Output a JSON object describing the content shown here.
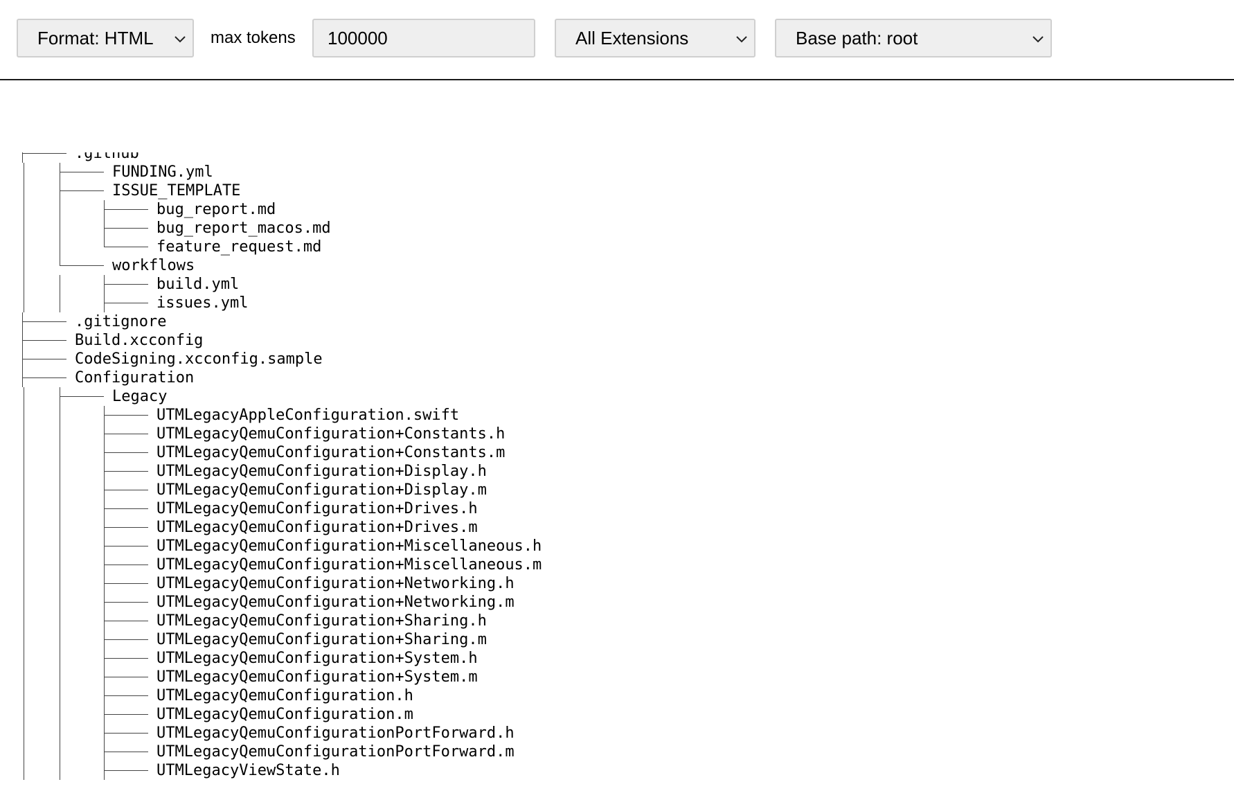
{
  "toolbar": {
    "format_label": "Format: HTML",
    "max_tokens_label": "max tokens",
    "max_tokens_value": "100000",
    "extensions_label": "All Extensions",
    "base_path_label": "Base path: root"
  },
  "tree": [
    {
      "name": ".github",
      "depth": 0,
      "last": false
    },
    {
      "name": "FUNDING.yml",
      "depth": 1,
      "last": false
    },
    {
      "name": "ISSUE_TEMPLATE",
      "depth": 1,
      "last": false
    },
    {
      "name": "bug_report.md",
      "depth": 2,
      "last": false
    },
    {
      "name": "bug_report_macos.md",
      "depth": 2,
      "last": false
    },
    {
      "name": "feature_request.md",
      "depth": 2,
      "last": true
    },
    {
      "name": "workflows",
      "depth": 1,
      "last": true
    },
    {
      "name": "build.yml",
      "depth": 2,
      "last": false
    },
    {
      "name": "issues.yml",
      "depth": 2,
      "last": false
    },
    {
      "name": ".gitignore",
      "depth": 0,
      "last": false
    },
    {
      "name": "Build.xcconfig",
      "depth": 0,
      "last": false
    },
    {
      "name": "CodeSigning.xcconfig.sample",
      "depth": 0,
      "last": false
    },
    {
      "name": "Configuration",
      "depth": 0,
      "last": false
    },
    {
      "name": "Legacy",
      "depth": 1,
      "last": false
    },
    {
      "name": "UTMLegacyAppleConfiguration.swift",
      "depth": 2,
      "last": false
    },
    {
      "name": "UTMLegacyQemuConfiguration+Constants.h",
      "depth": 2,
      "last": false
    },
    {
      "name": "UTMLegacyQemuConfiguration+Constants.m",
      "depth": 2,
      "last": false
    },
    {
      "name": "UTMLegacyQemuConfiguration+Display.h",
      "depth": 2,
      "last": false
    },
    {
      "name": "UTMLegacyQemuConfiguration+Display.m",
      "depth": 2,
      "last": false
    },
    {
      "name": "UTMLegacyQemuConfiguration+Drives.h",
      "depth": 2,
      "last": false
    },
    {
      "name": "UTMLegacyQemuConfiguration+Drives.m",
      "depth": 2,
      "last": false
    },
    {
      "name": "UTMLegacyQemuConfiguration+Miscellaneous.h",
      "depth": 2,
      "last": false
    },
    {
      "name": "UTMLegacyQemuConfiguration+Miscellaneous.m",
      "depth": 2,
      "last": false
    },
    {
      "name": "UTMLegacyQemuConfiguration+Networking.h",
      "depth": 2,
      "last": false
    },
    {
      "name": "UTMLegacyQemuConfiguration+Networking.m",
      "depth": 2,
      "last": false
    },
    {
      "name": "UTMLegacyQemuConfiguration+Sharing.h",
      "depth": 2,
      "last": false
    },
    {
      "name": "UTMLegacyQemuConfiguration+Sharing.m",
      "depth": 2,
      "last": false
    },
    {
      "name": "UTMLegacyQemuConfiguration+System.h",
      "depth": 2,
      "last": false
    },
    {
      "name": "UTMLegacyQemuConfiguration+System.m",
      "depth": 2,
      "last": false
    },
    {
      "name": "UTMLegacyQemuConfiguration.h",
      "depth": 2,
      "last": false
    },
    {
      "name": "UTMLegacyQemuConfiguration.m",
      "depth": 2,
      "last": false
    },
    {
      "name": "UTMLegacyQemuConfigurationPortForward.h",
      "depth": 2,
      "last": false
    },
    {
      "name": "UTMLegacyQemuConfigurationPortForward.m",
      "depth": 2,
      "last": false
    },
    {
      "name": "UTMLegacyViewState.h",
      "depth": 2,
      "last": false
    }
  ]
}
